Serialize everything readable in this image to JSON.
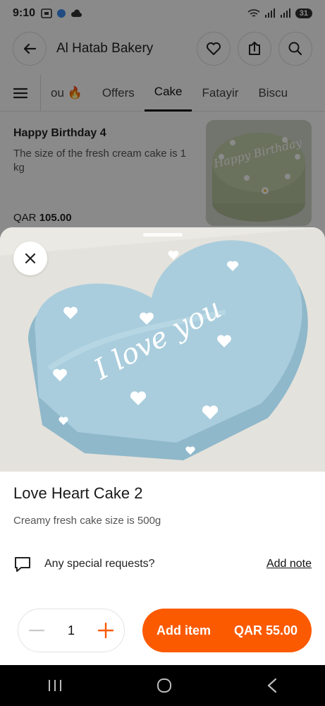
{
  "status_bar": {
    "time": "9:10",
    "battery": "31"
  },
  "header": {
    "title": "Al Hatab Bakery"
  },
  "tabs": [
    {
      "label": "ou 🔥"
    },
    {
      "label": "Offers"
    },
    {
      "label": "Cake",
      "active": true
    },
    {
      "label": "Fatayir"
    },
    {
      "label": "Biscu"
    }
  ],
  "background_product": {
    "name": "Happy Birthday 4",
    "description": "The size of the fresh cream cake is 1 kg",
    "currency": "QAR",
    "price": "105.00",
    "image_text": "Happy Birthday"
  },
  "sheet": {
    "image_text": "I love you",
    "name": "Love Heart Cake 2",
    "description": "Creamy fresh cake size is 500g",
    "special_requests_label": "Any special requests?",
    "add_note_label": "Add note",
    "quantity": "1",
    "add_item_label": "Add item",
    "total": "QAR 55.00"
  },
  "colors": {
    "accent": "#fb5a00",
    "cake_blue": "#a9cddd",
    "cake_green": "#c2d1ad"
  },
  "icons": {
    "back": "arrow-left-icon",
    "favorite": "heart-icon",
    "share": "share-icon",
    "search": "search-icon",
    "menu": "hamburger-icon",
    "close": "close-icon",
    "note": "chat-bubble-icon",
    "minus": "minus-icon",
    "plus": "plus-icon"
  }
}
